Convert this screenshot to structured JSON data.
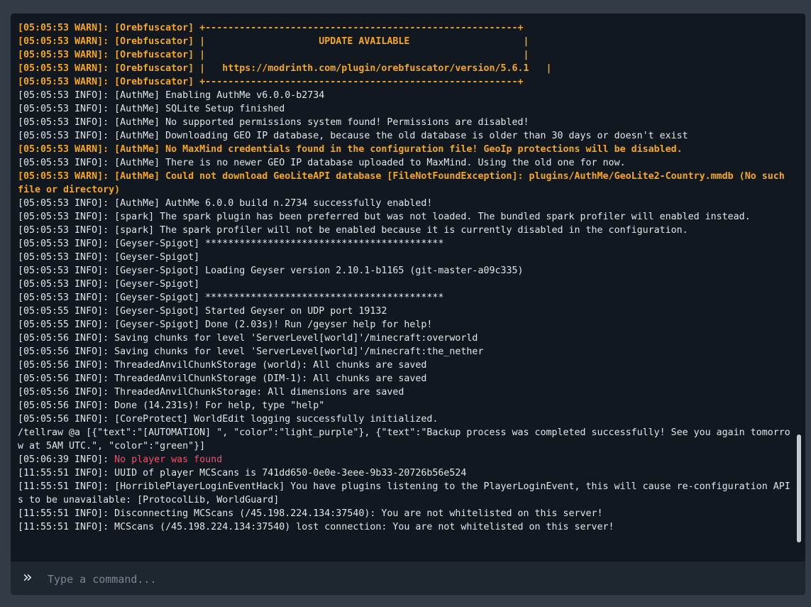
{
  "console": {
    "lines": [
      {
        "level": "warn",
        "text": "[05:05:53 WARN]: [Orebfuscator] +-------------------------------------------------------+"
      },
      {
        "level": "warn",
        "text": "[05:05:53 WARN]: [Orebfuscator] |                    UPDATE AVAILABLE                    |"
      },
      {
        "level": "warn",
        "text": "[05:05:53 WARN]: [Orebfuscator] |                                                        |"
      },
      {
        "level": "warn",
        "text": "[05:05:53 WARN]: [Orebfuscator] |   https://modrinth.com/plugin/orebfuscator/version/5.6.1   |"
      },
      {
        "level": "warn",
        "text": "[05:05:53 WARN]: [Orebfuscator] +-------------------------------------------------------+"
      },
      {
        "level": "info",
        "text": "[05:05:53 INFO]: [AuthMe] Enabling AuthMe v6.0.0-b2734"
      },
      {
        "level": "info",
        "text": "[05:05:53 INFO]: [AuthMe] SQLite Setup finished"
      },
      {
        "level": "info",
        "text": "[05:05:53 INFO]: [AuthMe] No supported permissions system found! Permissions are disabled!"
      },
      {
        "level": "info",
        "text": "[05:05:53 INFO]: [AuthMe] Downloading GEO IP database, because the old database is older than 30 days or doesn't exist"
      },
      {
        "level": "warn",
        "text": "[05:05:53 WARN]: [AuthMe] No MaxMind credentials found in the configuration file! GeoIp protections will be disabled."
      },
      {
        "level": "info",
        "text": "[05:05:53 INFO]: [AuthMe] There is no newer GEO IP database uploaded to MaxMind. Using the old one for now."
      },
      {
        "level": "warn",
        "text": "[05:05:53 WARN]: [AuthMe] Could not download GeoLiteAPI database [FileNotFoundException]: plugins/AuthMe/GeoLite2-Country.mmdb (No such file or directory)"
      },
      {
        "level": "info",
        "text": "[05:05:53 INFO]: [AuthMe] AuthMe 6.0.0 build n.2734 successfully enabled!"
      },
      {
        "level": "info",
        "text": "[05:05:53 INFO]: [spark] The spark plugin has been preferred but was not loaded. The bundled spark profiler will enabled instead."
      },
      {
        "level": "info",
        "text": "[05:05:53 INFO]: [spark] The spark profiler will not be enabled because it is currently disabled in the configuration."
      },
      {
        "level": "info",
        "text": "[05:05:53 INFO]: [Geyser-Spigot] ******************************************"
      },
      {
        "level": "info",
        "text": "[05:05:53 INFO]: [Geyser-Spigot]"
      },
      {
        "level": "info",
        "text": "[05:05:53 INFO]: [Geyser-Spigot] Loading Geyser version 2.10.1-b1165 (git-master-a09c335)"
      },
      {
        "level": "info",
        "text": "[05:05:53 INFO]: [Geyser-Spigot]"
      },
      {
        "level": "info",
        "text": "[05:05:53 INFO]: [Geyser-Spigot] ******************************************"
      },
      {
        "level": "info",
        "text": "[05:05:55 INFO]: [Geyser-Spigot] Started Geyser on UDP port 19132"
      },
      {
        "level": "info",
        "text": "[05:05:55 INFO]: [Geyser-Spigot] Done (2.03s)! Run /geyser help for help!"
      },
      {
        "level": "info",
        "text": "[05:05:56 INFO]: Saving chunks for level 'ServerLevel[world]'/minecraft:overworld"
      },
      {
        "level": "info",
        "text": "[05:05:56 INFO]: Saving chunks for level 'ServerLevel[world]'/minecraft:the_nether"
      },
      {
        "level": "info",
        "text": "[05:05:56 INFO]: ThreadedAnvilChunkStorage (world): All chunks are saved"
      },
      {
        "level": "info",
        "text": "[05:05:56 INFO]: ThreadedAnvilChunkStorage (DIM-1): All chunks are saved"
      },
      {
        "level": "info",
        "text": "[05:05:56 INFO]: ThreadedAnvilChunkStorage: All dimensions are saved"
      },
      {
        "level": "info",
        "text": "[05:05:56 INFO]: Done (14.231s)! For help, type \"help\""
      },
      {
        "level": "info",
        "text": "[05:05:56 INFO]: [CoreProtect] WorldEdit logging successfully initialized."
      },
      {
        "level": "info",
        "text": "/tellraw @a [{\"text\":\"[AUTOMATION] \", \"color\":\"light_purple\"}, {\"text\":\"Backup process was completed successfully! See you again tomorrow at 5AM UTC.\", \"color\":\"green\"}]"
      },
      {
        "level": "info",
        "text": "[05:06:39 INFO]: ",
        "error_text": "No player was found"
      },
      {
        "level": "info",
        "text": "[11:55:51 INFO]: UUID of player MCScans is 741dd650-0e0e-3eee-9b33-20726b56e524"
      },
      {
        "level": "info",
        "text": "[11:55:51 INFO]: [HorriblePlayerLoginEventHack] You have plugins listening to the PlayerLoginEvent, this will cause re-configuration APIs to be unavailable: [ProtocolLib, WorldGuard]"
      },
      {
        "level": "info",
        "text": "[11:55:51 INFO]: Disconnecting MCScans (/45.198.224.134:37540): You are not whitelisted on this server!"
      },
      {
        "level": "info",
        "text": "[11:55:51 INFO]: MCScans (/45.198.224.134:37540) lost connection: You are not whitelisted on this server!"
      }
    ]
  },
  "input": {
    "placeholder": "Type a command...",
    "value": "",
    "icon": "chevrons-right-icon"
  }
}
